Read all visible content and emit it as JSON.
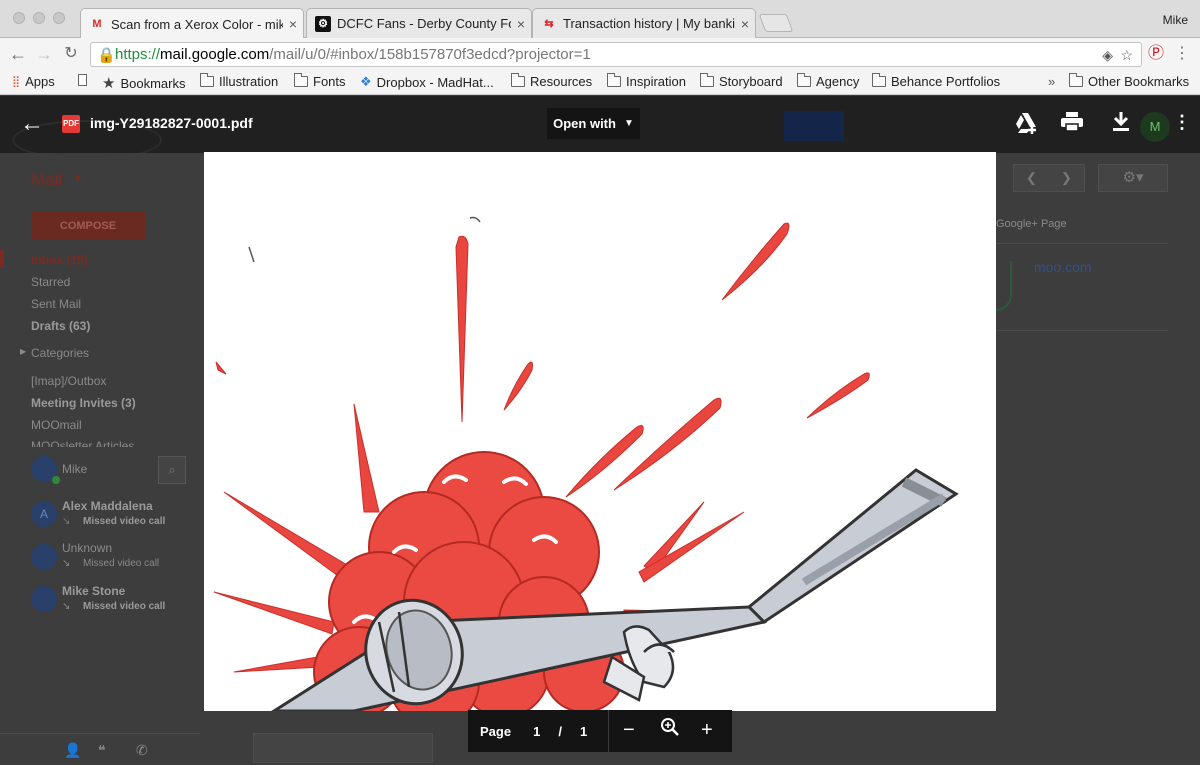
{
  "browser": {
    "profile": "Mike",
    "tabs": [
      {
        "title": "Scan from a Xerox Color - mik",
        "favicon": "gmail-icon",
        "active": true
      },
      {
        "title": "DCFC Fans - Derby County Fo",
        "favicon": "dcfc-icon",
        "active": false
      },
      {
        "title": "Transaction history | My banki",
        "favicon": "bank-icon",
        "active": false
      }
    ],
    "url": {
      "scheme": "https://",
      "host": "mail.google.com",
      "path": "/mail/u/0/#inbox/158b157870f3edcd?projector=1"
    },
    "bookmarks": [
      {
        "label": "Apps",
        "icon": "apps-grid-icon"
      },
      {
        "label": "",
        "icon": "page-icon"
      },
      {
        "label": "Bookmarks",
        "icon": "star-icon"
      },
      {
        "label": "Illustration",
        "icon": "folder-icon"
      },
      {
        "label": "Fonts",
        "icon": "folder-icon"
      },
      {
        "label": "Dropbox - MadHat...",
        "icon": "dropbox-icon"
      },
      {
        "label": "Resources",
        "icon": "folder-icon"
      },
      {
        "label": "Inspiration",
        "icon": "folder-icon"
      },
      {
        "label": "Storyboard",
        "icon": "folder-icon"
      },
      {
        "label": "Agency",
        "icon": "folder-icon"
      },
      {
        "label": "Behance Portfolios",
        "icon": "folder-icon"
      }
    ],
    "overflow": "»",
    "other_bookmarks": "Other Bookmarks"
  },
  "gmail": {
    "mail_label": "Mail",
    "compose": "COMPOSE",
    "nav": [
      "Inbox (15)",
      "Starred",
      "Sent Mail",
      "Drafts (63)",
      "Categories",
      "[Imap]/Outbox",
      "Meeting Invites (3)",
      "MOOmail",
      "MOOsletter Articles"
    ],
    "chat_user": "Mike",
    "contacts": [
      {
        "name": "Alex Maddalena",
        "status": "Missed video call",
        "initial": "A"
      },
      {
        "name": "Unknown",
        "status": "Missed video call",
        "initial": ""
      },
      {
        "name": "Mike Stone",
        "status": "Missed video call",
        "initial": ""
      }
    ],
    "right_panel": {
      "google_plus": "Google+ Page",
      "link": "moo.com"
    }
  },
  "viewer": {
    "filename": "img-Y29182827-0001.pdf",
    "file_badge": "PDF",
    "open_with": "Open with",
    "avatar_initial": "M",
    "pager": {
      "label": "Page",
      "current": "1",
      "separator": "/",
      "total": "1"
    },
    "icons": [
      "back-arrow-icon",
      "add-to-drive-icon",
      "print-icon",
      "download-icon",
      "more-vert-icon",
      "zoom-out-icon",
      "zoom-icon",
      "zoom-in-icon"
    ],
    "colors": {
      "overlay": "#1a1a1a",
      "ink_red": "#e8463e",
      "ink_gray": "#9aa0aa"
    }
  }
}
